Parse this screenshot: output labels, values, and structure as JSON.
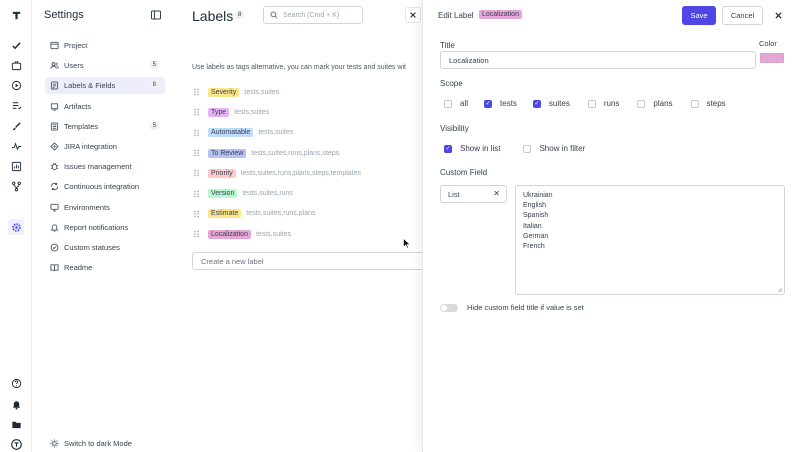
{
  "colors": {
    "accent": "#4f46e5",
    "localization": "#e7a6d8",
    "severity": "#fde68a",
    "type": "#e9b3f5",
    "automatable": "#bfdbfe",
    "to_review": "#b8c2f2",
    "priority": "#fecaca",
    "version": "#bbf7d0",
    "estimate": "#fde68a"
  },
  "sidebar": {
    "title": "Settings",
    "items": [
      {
        "label": "Project",
        "icon": "project-icon",
        "count": ""
      },
      {
        "label": "Users",
        "icon": "users-icon",
        "count": "5"
      },
      {
        "label": "Labels & Fields",
        "icon": "labels-icon",
        "count": "8"
      },
      {
        "label": "Artifacts",
        "icon": "artifacts-icon",
        "count": ""
      },
      {
        "label": "Templates",
        "icon": "templates-icon",
        "count": "5"
      },
      {
        "label": "JIRA integration",
        "icon": "jira-icon",
        "count": ""
      },
      {
        "label": "Issues management",
        "icon": "issues-icon",
        "count": ""
      },
      {
        "label": "Continuous integration",
        "icon": "ci-icon",
        "count": ""
      },
      {
        "label": "Environments",
        "icon": "environments-icon",
        "count": ""
      },
      {
        "label": "Report notifications",
        "icon": "notifications-icon",
        "count": ""
      },
      {
        "label": "Custom statuses",
        "icon": "statuses-icon",
        "count": ""
      },
      {
        "label": "Readme",
        "icon": "readme-icon",
        "count": ""
      }
    ],
    "dark_mode_label": "Switch to dark Mode"
  },
  "labels_panel": {
    "title": "Labels",
    "count": "8",
    "search_placeholder": "Search (Cmd + K)",
    "description": "Use labels as tags alternative, you can mark your tests and suites wit",
    "labels": [
      {
        "name": "Severity",
        "scope": "tests,suites"
      },
      {
        "name": "Type",
        "scope": "tests,suites"
      },
      {
        "name": "Automatable",
        "scope": "tests,suites"
      },
      {
        "name": "To Review",
        "scope": "tests,suites,runs,plans,steps"
      },
      {
        "name": "Priority",
        "scope": "tests,suites,runs,plans,steps,templates"
      },
      {
        "name": "Version",
        "scope": "tests,suites,runs"
      },
      {
        "name": "Estimate",
        "scope": "tests,suites,runs,plans"
      },
      {
        "name": "Localization",
        "scope": "tests,suites"
      }
    ],
    "new_label_placeholder": "Create a new label"
  },
  "edit": {
    "header": "Edit Label",
    "tag": "Localization",
    "save": "Save",
    "cancel": "Cancel",
    "title_label": "Title",
    "title_value": "Localization",
    "color_label": "Color",
    "scope_label": "Scope",
    "scope_options": [
      {
        "label": "all",
        "checked": false
      },
      {
        "label": "tests",
        "checked": true
      },
      {
        "label": "suites",
        "checked": true
      },
      {
        "label": "runs",
        "checked": false
      },
      {
        "label": "plans",
        "checked": false
      },
      {
        "label": "steps",
        "checked": false
      }
    ],
    "visibility_label": "Visibility",
    "visibility_options": [
      {
        "label": "Show in list",
        "checked": true
      },
      {
        "label": "Show in filter",
        "checked": false
      }
    ],
    "custom_field_label": "Custom Field",
    "custom_field_type": "List",
    "custom_field_values": [
      "Ukrainian",
      "English",
      "Spanish",
      "Italian",
      "German",
      "French"
    ],
    "hide_title_label": "Hide custom field title if value is set",
    "hide_title_on": false
  }
}
